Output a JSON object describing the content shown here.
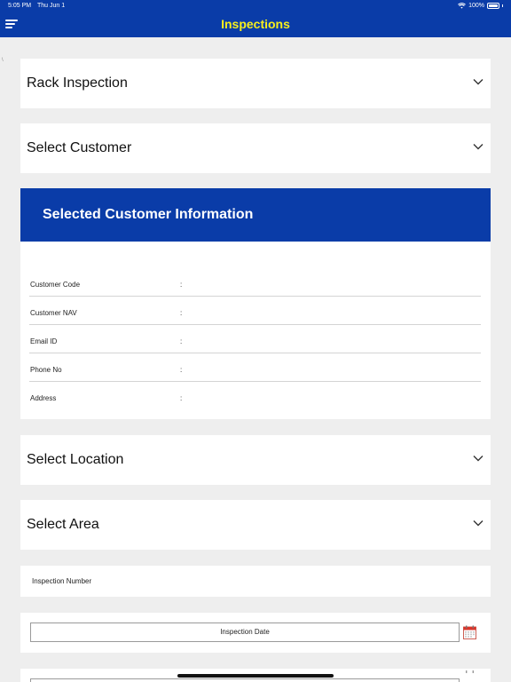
{
  "status_bar": {
    "time": "5:05 PM",
    "date": "Thu Jun 1",
    "battery": "100%"
  },
  "header": {
    "title": "Inspections",
    "menu_icon": "hamburger-menu-icon"
  },
  "colors": {
    "header_bg": "#0a3ca8",
    "title": "#f7ef1c",
    "page_bg": "#eeeeee",
    "card_bg": "#ffffff"
  },
  "dropdowns": {
    "inspection_type": {
      "label": "Rack Inspection",
      "icon": "chevron-down-icon"
    },
    "customer": {
      "label": "Select Customer",
      "icon": "chevron-down-icon"
    },
    "location": {
      "label": "Select Location",
      "icon": "chevron-down-icon"
    },
    "area": {
      "label": "Select Area",
      "icon": "chevron-down-icon"
    }
  },
  "customer_info": {
    "title": "Selected Customer Information",
    "rows": [
      {
        "label": "Customer Code",
        "separator": ":",
        "value": ""
      },
      {
        "label": "Customer NAV",
        "separator": ":",
        "value": ""
      },
      {
        "label": "Email ID",
        "separator": ":",
        "value": ""
      },
      {
        "label": "Phone No",
        "separator": ":",
        "value": ""
      },
      {
        "label": "Address",
        "separator": ":",
        "value": ""
      }
    ]
  },
  "inspection_number": {
    "label": "Inspection Number"
  },
  "inspection_date": {
    "label": "Inspection Date",
    "icon": "calendar-icon"
  }
}
